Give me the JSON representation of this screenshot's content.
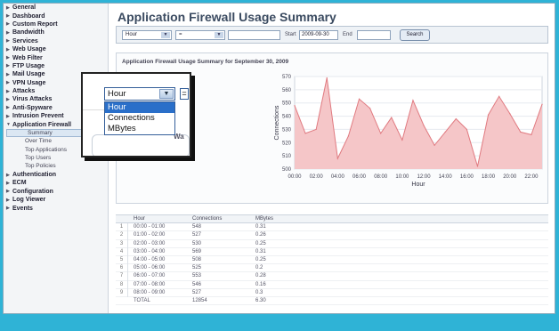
{
  "sidebar": {
    "items": [
      {
        "label": "General",
        "expanded": false
      },
      {
        "label": "Dashboard",
        "expanded": false
      },
      {
        "label": "Custom Report",
        "expanded": false
      },
      {
        "label": "Bandwidth",
        "expanded": false
      },
      {
        "label": "Services",
        "expanded": false
      },
      {
        "label": "Web Usage",
        "expanded": false
      },
      {
        "label": "Web Filter",
        "expanded": false
      },
      {
        "label": "FTP Usage",
        "expanded": false
      },
      {
        "label": "Mail Usage",
        "expanded": false
      },
      {
        "label": "VPN Usage",
        "expanded": false
      },
      {
        "label": "Attacks",
        "expanded": false
      },
      {
        "label": "Virus Attacks",
        "expanded": false
      },
      {
        "label": "Anti-Spyware",
        "expanded": false
      },
      {
        "label": "Intrusion Prevent",
        "expanded": false
      },
      {
        "label": "Application Firewall",
        "expanded": true
      }
    ],
    "subitems": [
      "Summary",
      "Over Time",
      "Top Applications",
      "Top Users",
      "Top Policies"
    ],
    "active_subitem": "Summary",
    "items_after": [
      {
        "label": "Authentication",
        "expanded": false
      },
      {
        "label": "ECM",
        "expanded": false
      },
      {
        "label": "Configuration",
        "expanded": false
      },
      {
        "label": "Log Viewer",
        "expanded": false
      },
      {
        "label": "Events",
        "expanded": false
      }
    ]
  },
  "header": {
    "title": "Application Firewall Usage Summary"
  },
  "filter": {
    "field_value": "Hour",
    "operator_value": "=",
    "start_label": "Start",
    "start_value": "2009-09-30",
    "end_label": "End",
    "search_label": "Search"
  },
  "panel": {
    "title": "Application Firewall Usage Summary for September 30, 2009"
  },
  "chart_data": {
    "type": "area",
    "title": "",
    "xlabel": "Hour",
    "ylabel": "Connections",
    "ylim": [
      500,
      570
    ],
    "yticks": [
      500,
      510,
      520,
      530,
      540,
      550,
      560,
      570
    ],
    "x": [
      "00:00",
      "01:00",
      "02:00",
      "03:00",
      "04:00",
      "05:00",
      "06:00",
      "07:00",
      "08:00",
      "09:00",
      "10:00",
      "11:00",
      "12:00",
      "13:00",
      "14:00",
      "15:00",
      "16:00",
      "17:00",
      "18:00",
      "19:00",
      "20:00",
      "21:00",
      "22:00",
      "23:00"
    ],
    "xtick_labels": [
      "00:00",
      "02:00",
      "04:00",
      "06:00",
      "08:00",
      "10:00",
      "12:00",
      "14:00",
      "16:00",
      "18:00",
      "20:00",
      "22:00"
    ],
    "series": [
      {
        "values": [
          548,
          527,
          530,
          569,
          508,
          525,
          553,
          546,
          527,
          539,
          522,
          552,
          533,
          518,
          528,
          538,
          530,
          502,
          541,
          555,
          542,
          528,
          526,
          549
        ]
      }
    ],
    "fill_color": "#f5c6c8",
    "line_color": "#e07a80",
    "grid": true
  },
  "table": {
    "headers": [
      "Hour",
      "Connections",
      "MBytes"
    ],
    "rows": [
      {
        "idx": "1",
        "hour": "00:00 - 01:00",
        "connections": "548",
        "mbytes": "0.31"
      },
      {
        "idx": "2",
        "hour": "01:00 - 02:00",
        "connections": "527",
        "mbytes": "0.26"
      },
      {
        "idx": "3",
        "hour": "02:00 - 03:00",
        "connections": "530",
        "mbytes": "0.25"
      },
      {
        "idx": "4",
        "hour": "03:00 - 04:00",
        "connections": "569",
        "mbytes": "0.31"
      },
      {
        "idx": "5",
        "hour": "04:00 - 05:00",
        "connections": "508",
        "mbytes": "0.25"
      },
      {
        "idx": "6",
        "hour": "05:00 - 06:00",
        "connections": "525",
        "mbytes": "0.2"
      },
      {
        "idx": "7",
        "hour": "06:00 - 07:00",
        "connections": "553",
        "mbytes": "0.28"
      },
      {
        "idx": "8",
        "hour": "07:00 - 08:00",
        "connections": "546",
        "mbytes": "0.16"
      },
      {
        "idx": "9",
        "hour": "08:00 - 09:00",
        "connections": "527",
        "mbytes": "0.3"
      }
    ],
    "total": {
      "label": "TOTAL",
      "connections": "12854",
      "mbytes": "6.30"
    }
  },
  "zoom": {
    "selected": "Hour",
    "operator": "=",
    "options": [
      "Hour",
      "Connections",
      "MBytes"
    ],
    "highlighted": "Hour",
    "fragment_text": "Wa"
  },
  "colors": {
    "background": "#2fb3d6",
    "accent": "#2a6fc9",
    "title": "#3a4a60"
  }
}
